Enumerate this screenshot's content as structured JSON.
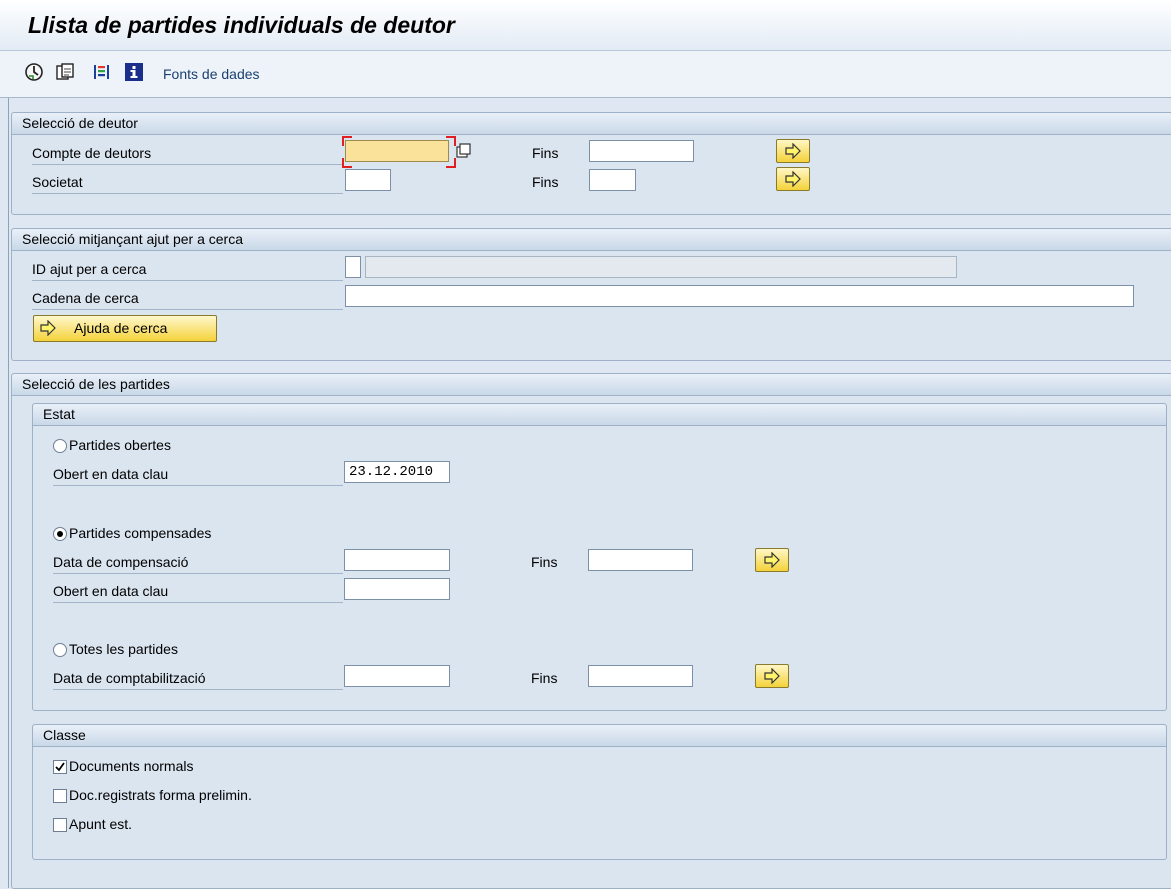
{
  "window": {
    "title": "Llista de partides individuals de deutor"
  },
  "toolbar": {
    "items": [
      {
        "icon": "execute-icon"
      },
      {
        "icon": "copy-variant-icon"
      },
      {
        "icon": "multicolor-list-icon"
      },
      {
        "icon": "info-icon"
      }
    ],
    "data_sources_label": "Fonts de dades"
  },
  "debtor_selection": {
    "title": "Selecció de deutor",
    "account_label": "Compte de deutors",
    "account_value": "",
    "account_to_label": "Fins",
    "account_to_value": "",
    "company_label": "Societat",
    "company_value": "",
    "company_to_label": "Fins",
    "company_to_value": ""
  },
  "search_help": {
    "title": "Selecció mitjançant ajut per a cerca",
    "id_label": "ID ajut per a cerca",
    "id_value": "",
    "id_desc": "",
    "string_label": "Cadena de cerca",
    "string_value": "",
    "button_label": "Ajuda de cerca"
  },
  "items_selection": {
    "title": "Selecció de les partides",
    "status": {
      "title": "Estat",
      "open_items_label": "Partides obertes",
      "open_items_selected": false,
      "open_key_date_label": "Obert en data clau",
      "open_key_date_value": "23.12.2010",
      "cleared_items_label": "Partides compensades",
      "cleared_items_selected": true,
      "clearing_date_label": "Data de compensació",
      "clearing_date_value": "",
      "clearing_to_label": "Fins",
      "clearing_to_value": "",
      "cleared_key_date_label": "Obert en data clau",
      "cleared_key_date_value": "",
      "all_items_label": "Totes les partides",
      "all_items_selected": false,
      "posting_date_label": "Data de comptabilització",
      "posting_date_value": "",
      "posting_to_label": "Fins",
      "posting_to_value": ""
    },
    "type": {
      "title": "Classe",
      "normal_docs_label": "Documents normals",
      "normal_docs_checked": true,
      "parked_docs_label": "Doc.registrats forma prelimin.",
      "parked_docs_checked": false,
      "statistical_label": "Apunt est.",
      "statistical_checked": false
    }
  },
  "colors": {
    "background": "#dfe8f2",
    "focus_field": "#fbe29a",
    "button_yellow": "#f4d23a"
  }
}
